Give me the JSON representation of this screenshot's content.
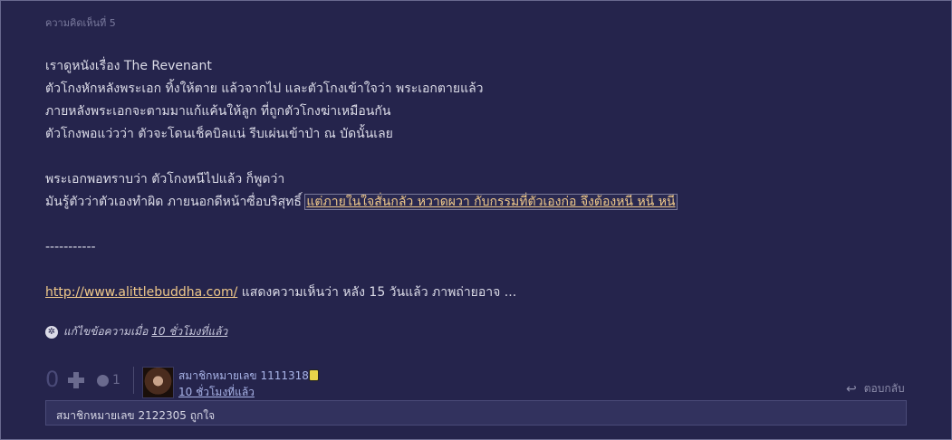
{
  "comment": {
    "number_label": "ความคิดเห็นที่ 5",
    "lines": [
      "เราดูหนังเรื่อง The Revenant",
      "ตัวโกงหักหลังพระเอก ทิ้งให้ตาย แล้วจากไป และตัวโกงเข้าใจว่า พระเอกตายแล้ว",
      "ภายหลังพระเอกจะตามมาแก้แค้นให้ลูก ที่ถูกตัวโกงฆ่าเหมือนกัน",
      "ตัวโกงพอแว่วว่า ตัวจะโดนเช็คบิลแน่ รีบเผ่นเข้าป่า ณ บัดนั้นเลย",
      "",
      "พระเอกพอทราบว่า ตัวโกงหนีไปแล้ว ก็พูดว่า"
    ],
    "line7_prefix": "มันรู้ตัวว่าตัวเองทำผิด ภายนอกดีหน้าซื่อบริสุทธิ์ ",
    "line7_link": "แต่ภายในใจสั่นกลัว หวาดผวา กับกรรมที่ตัวเองก่อ จึงต้องหนี หนี หนี",
    "divider": "-----------",
    "url": "http://www.alittlebuddha.com/",
    "url_suffix": " แสดงความเห็นว่า หลัง 15 วันแล้ว ภาพถ่ายอาจ ...",
    "edited_label": "แก้ไขข้อความเมื่อ",
    "edited_time": "10 ชั่วโมงที่แล้ว"
  },
  "footer": {
    "vote_count": "0",
    "emotion_count": "1",
    "member_name": "สมาชิกหมายเลข 1111318",
    "post_time": "10 ชั่วโมงที่แล้ว",
    "reply_label": "ตอบกลับ",
    "likes_text": "สมาชิกหมายเลข 2122305 ถูกใจ"
  }
}
